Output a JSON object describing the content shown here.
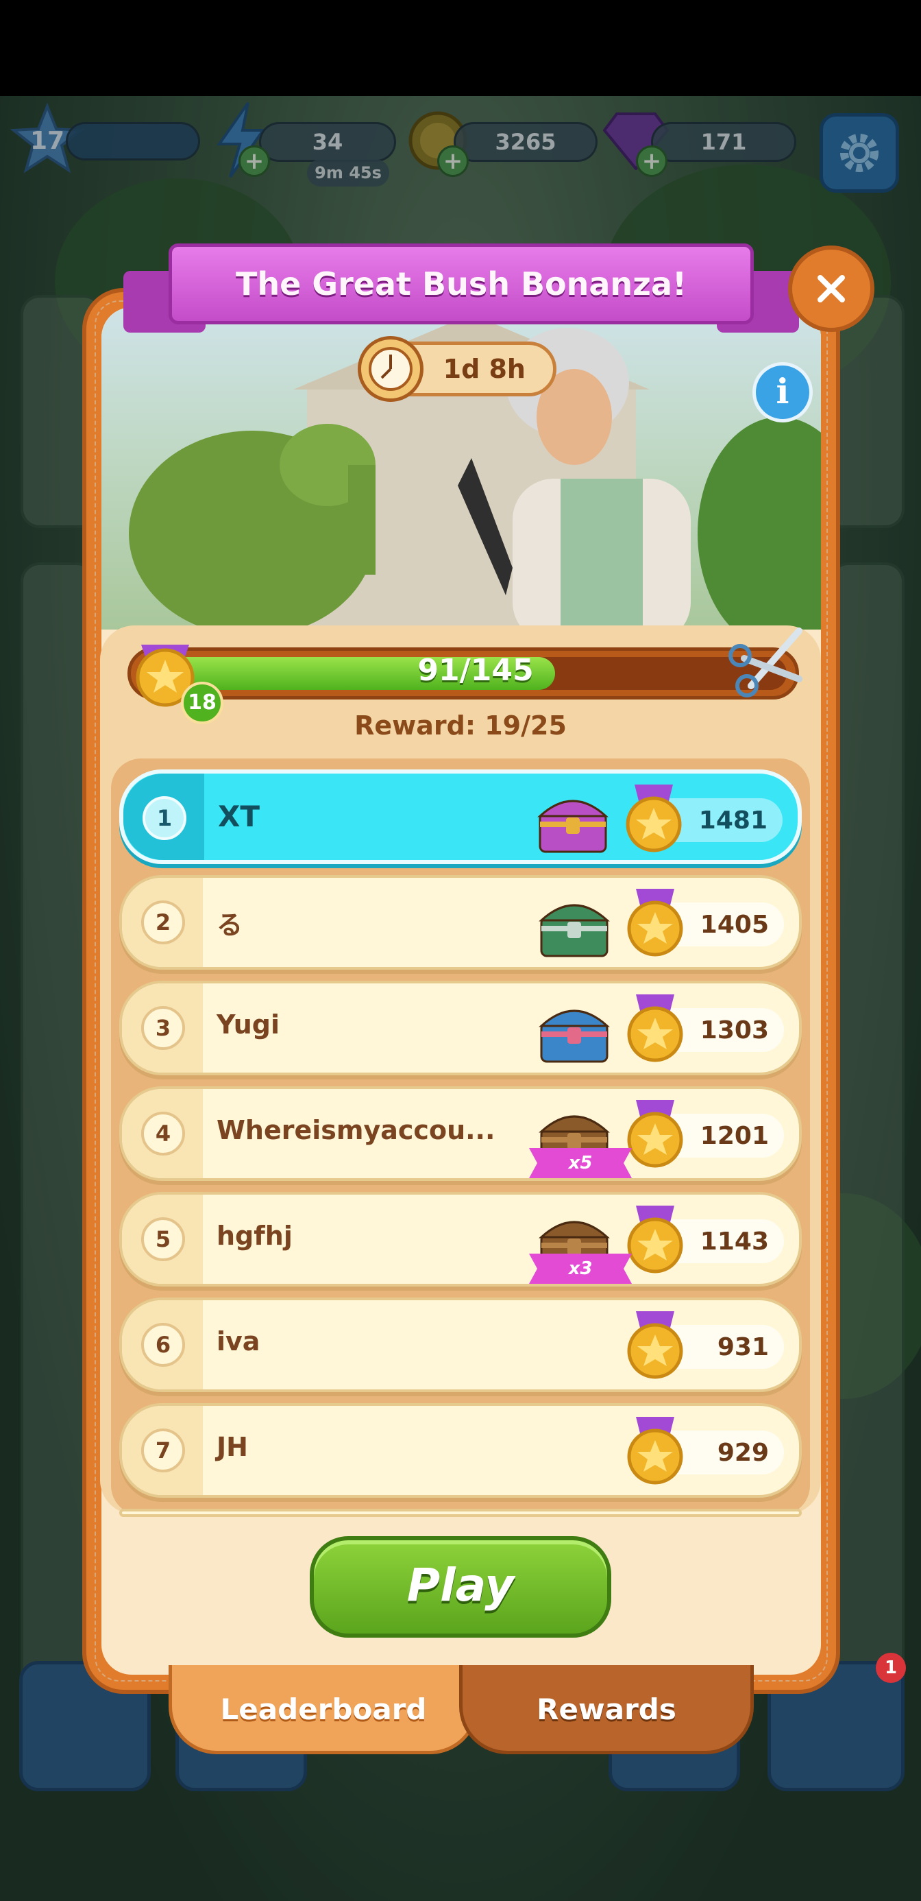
{
  "hud": {
    "level_value": "17",
    "energy": "34",
    "energy_timer": "9m 45s",
    "coins": "3265",
    "gems": "171"
  },
  "popup": {
    "title": "The Great Bush Bonanza!",
    "timer": "1d 8h",
    "info_label": "i",
    "progress": {
      "text": "91/145",
      "current": 91,
      "max": 145,
      "level_badge": "18"
    },
    "reward_text": "Reward: 19/25"
  },
  "leaderboard": [
    {
      "rank": "1",
      "name": "XT",
      "score": "1481",
      "reward": "purple-chest",
      "highlight": true
    },
    {
      "rank": "2",
      "name": "る",
      "score": "1405",
      "reward": "green-chest"
    },
    {
      "rank": "3",
      "name": "Yugi",
      "score": "1303",
      "reward": "blue-chest"
    },
    {
      "rank": "4",
      "name": "Whereismyaccou...",
      "score": "1201",
      "reward": "wooden-crate",
      "multiplier": "x5"
    },
    {
      "rank": "5",
      "name": "hgfhj",
      "score": "1143",
      "reward": "wooden-crate",
      "multiplier": "x3"
    },
    {
      "rank": "6",
      "name": "iva",
      "score": "931"
    },
    {
      "rank": "7",
      "name": "JH",
      "score": "929"
    }
  ],
  "play_label": "Play",
  "tabs": {
    "leaderboard": "Leaderboard",
    "rewards": "Rewards"
  },
  "notification_badge": "1",
  "colors": {
    "popup_frame": "#e07c2c",
    "ribbon": "#c44cc9",
    "highlight_row": "#3ae6f5",
    "play_button": "#5ba51d"
  }
}
